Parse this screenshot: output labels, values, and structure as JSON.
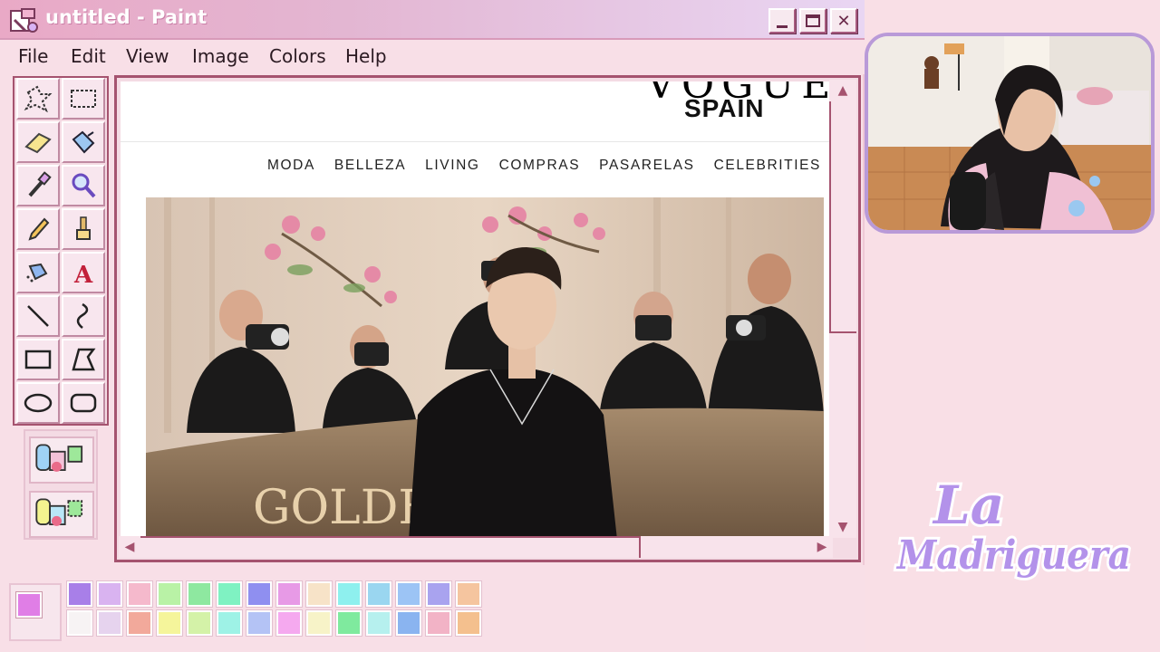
{
  "window": {
    "title": "untitled - Paint"
  },
  "menu": [
    "File",
    "Edit",
    "View",
    "Image",
    "Colors",
    "Help"
  ],
  "tools": [
    "free-select",
    "rect-select",
    "eraser",
    "fill",
    "color-picker",
    "magnifier",
    "pencil",
    "brush",
    "airbrush",
    "text",
    "line",
    "curve",
    "rectangle",
    "polygon",
    "ellipse",
    "rounded-rectangle"
  ],
  "site": {
    "logo": "VOGUE",
    "edition": "SPAIN",
    "nav": [
      "MODA",
      "BELLEZA",
      "LIVING",
      "COMPRAS",
      "PASARELAS",
      "CELEBRITIES"
    ],
    "photo_sign": "GOLDE          S"
  },
  "palette": {
    "foreground": "#e07ee6",
    "background": "#f8e9ef",
    "row1": [
      "#a87fe8",
      "#d9b3f0",
      "#f5b9cc",
      "#b9f2a6",
      "#8ee8a0",
      "#7ff2c2",
      "#8f8ff0",
      "#e79ae6",
      "#f7e3c8",
      "#8ef0ee",
      "#9ad6f0",
      "#9cc4f5",
      "#a9a3ef",
      "#f5c59f"
    ],
    "row2": [
      "#f7f3f4",
      "#e6d3ee",
      "#f2a99b",
      "#f5f59b",
      "#d4f2a8",
      "#9ef2e6",
      "#b4c3f5",
      "#f5a9ef",
      "#f7f3c8",
      "#7fea9e",
      "#b6f0ee",
      "#8ab4f0",
      "#f2b3c6",
      "#f4c08e"
    ]
  },
  "stream": {
    "logo_line1": "La",
    "logo_line2": "Madriguera"
  }
}
